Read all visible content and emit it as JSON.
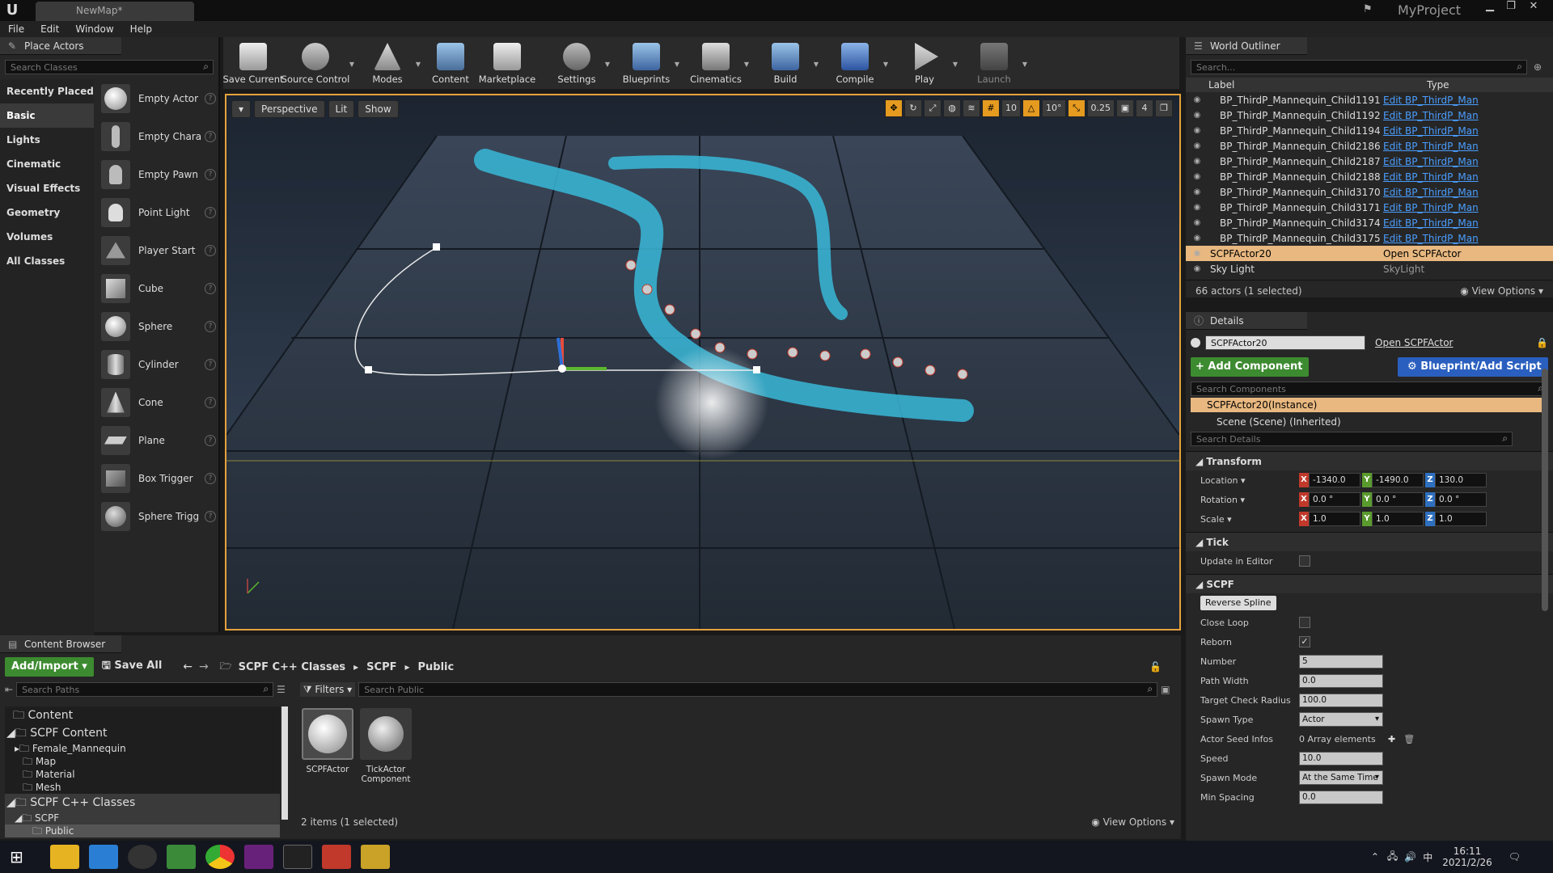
{
  "window": {
    "doc_tab": "NewMap*",
    "project_name": "MyProject"
  },
  "menu": [
    "File",
    "Edit",
    "Window",
    "Help"
  ],
  "place_actors": {
    "title": "Place Actors",
    "search_placeholder": "Search Classes",
    "categories": [
      "Recently Placed",
      "Basic",
      "Lights",
      "Cinematic",
      "Visual Effects",
      "Geometry",
      "Volumes",
      "All Classes"
    ],
    "items": [
      "Empty Actor",
      "Empty Chara",
      "Empty Pawn",
      "Point Light",
      "Player Start",
      "Cube",
      "Sphere",
      "Cylinder",
      "Cone",
      "Plane",
      "Box Trigger",
      "Sphere Trigg"
    ]
  },
  "toolbar": {
    "buttons": [
      "Save Current",
      "Source Control",
      "Modes",
      "Content",
      "Marketplace",
      "Settings",
      "Blueprints",
      "Cinematics",
      "Build",
      "Compile",
      "Play",
      "Launch"
    ]
  },
  "viewport": {
    "perspective": "Perspective",
    "lit": "Lit",
    "show": "Show",
    "grid_snap": "10",
    "rot_snap": "10°",
    "scale_snap": "0.25",
    "camera_speed": "4"
  },
  "outliner": {
    "title": "World Outliner",
    "search_placeholder": "Search...",
    "col_label": "Label",
    "col_type": "Type",
    "rows": [
      {
        "label": "BP_ThirdP_Mannequin_Child1191",
        "type": "Edit BP_ThirdP_Man"
      },
      {
        "label": "BP_ThirdP_Mannequin_Child1192",
        "type": "Edit BP_ThirdP_Man"
      },
      {
        "label": "BP_ThirdP_Mannequin_Child1194",
        "type": "Edit BP_ThirdP_Man"
      },
      {
        "label": "BP_ThirdP_Mannequin_Child2186",
        "type": "Edit BP_ThirdP_Man"
      },
      {
        "label": "BP_ThirdP_Mannequin_Child2187",
        "type": "Edit BP_ThirdP_Man"
      },
      {
        "label": "BP_ThirdP_Mannequin_Child2188",
        "type": "Edit BP_ThirdP_Man"
      },
      {
        "label": "BP_ThirdP_Mannequin_Child3170",
        "type": "Edit BP_ThirdP_Man"
      },
      {
        "label": "BP_ThirdP_Mannequin_Child3171",
        "type": "Edit BP_ThirdP_Man"
      },
      {
        "label": "BP_ThirdP_Mannequin_Child3174",
        "type": "Edit BP_ThirdP_Man"
      },
      {
        "label": "BP_ThirdP_Mannequin_Child3175",
        "type": "Edit BP_ThirdP_Man"
      },
      {
        "label": "SCPFActor20",
        "type": "Open SCPFActor"
      },
      {
        "label": "Sky Light",
        "type": "SkyLight"
      }
    ],
    "status": "66 actors (1 selected)",
    "view_options": "View Options"
  },
  "details": {
    "title": "Details",
    "actor_name": "SCPFActor20",
    "open_link": "Open SCPFActor",
    "add_component": "+ Add Component",
    "blueprint_script": "Blueprint/Add Script",
    "search_components": "Search Components",
    "instance": "SCPFActor20(Instance)",
    "scene": "Scene (Scene) (Inherited)",
    "search_details": "Search Details",
    "transform": "Transform",
    "location": {
      "label": "Location",
      "x": "-1340.0",
      "y": "-1490.0",
      "z": "130.0"
    },
    "rotation": {
      "label": "Rotation",
      "x": "0.0 °",
      "y": "0.0 °",
      "z": "0.0 °"
    },
    "scale": {
      "label": "Scale",
      "x": "1.0",
      "y": "1.0",
      "z": "1.0"
    },
    "tick": "Tick",
    "update_in_editor": "Update in Editor",
    "scpf": "SCPF",
    "reverse_spline": "Reverse Spline",
    "close_loop": "Close Loop",
    "reborn": "Reborn",
    "number": {
      "label": "Number",
      "value": "5"
    },
    "path_width": {
      "label": "Path Width",
      "value": "0.0"
    },
    "target_check_radius": {
      "label": "Target Check Radius",
      "value": "100.0"
    },
    "spawn_type": {
      "label": "Spawn Type",
      "value": "Actor"
    },
    "actor_seed_infos": {
      "label": "Actor Seed Infos",
      "value": "0 Array elements"
    },
    "speed": {
      "label": "Speed",
      "value": "10.0"
    },
    "spawn_mode": {
      "label": "Spawn Mode",
      "value": "At the Same Time"
    },
    "min_spacing": {
      "label": "Min Spacing",
      "value": "0.0"
    }
  },
  "content_browser": {
    "title": "Content Browser",
    "add_import": "Add/Import",
    "save_all": "Save All",
    "breadcrumb": [
      "SCPF C++ Classes",
      "SCPF",
      "Public"
    ],
    "search_paths": "Search Paths",
    "filters": "Filters",
    "search_public": "Search Public",
    "tree": [
      "Content",
      "SCPF Content",
      "Female_Mannequin",
      "Map",
      "Material",
      "Mesh",
      "SCPF C++ Classes",
      "SCPF",
      "Public"
    ],
    "assets": [
      "SCPFActor",
      "TickActor Component"
    ],
    "status": "2 items (1 selected)",
    "view_options": "View Options"
  },
  "taskbar": {
    "time": "16:11",
    "date": "2021/2/26",
    "ime": "中"
  }
}
